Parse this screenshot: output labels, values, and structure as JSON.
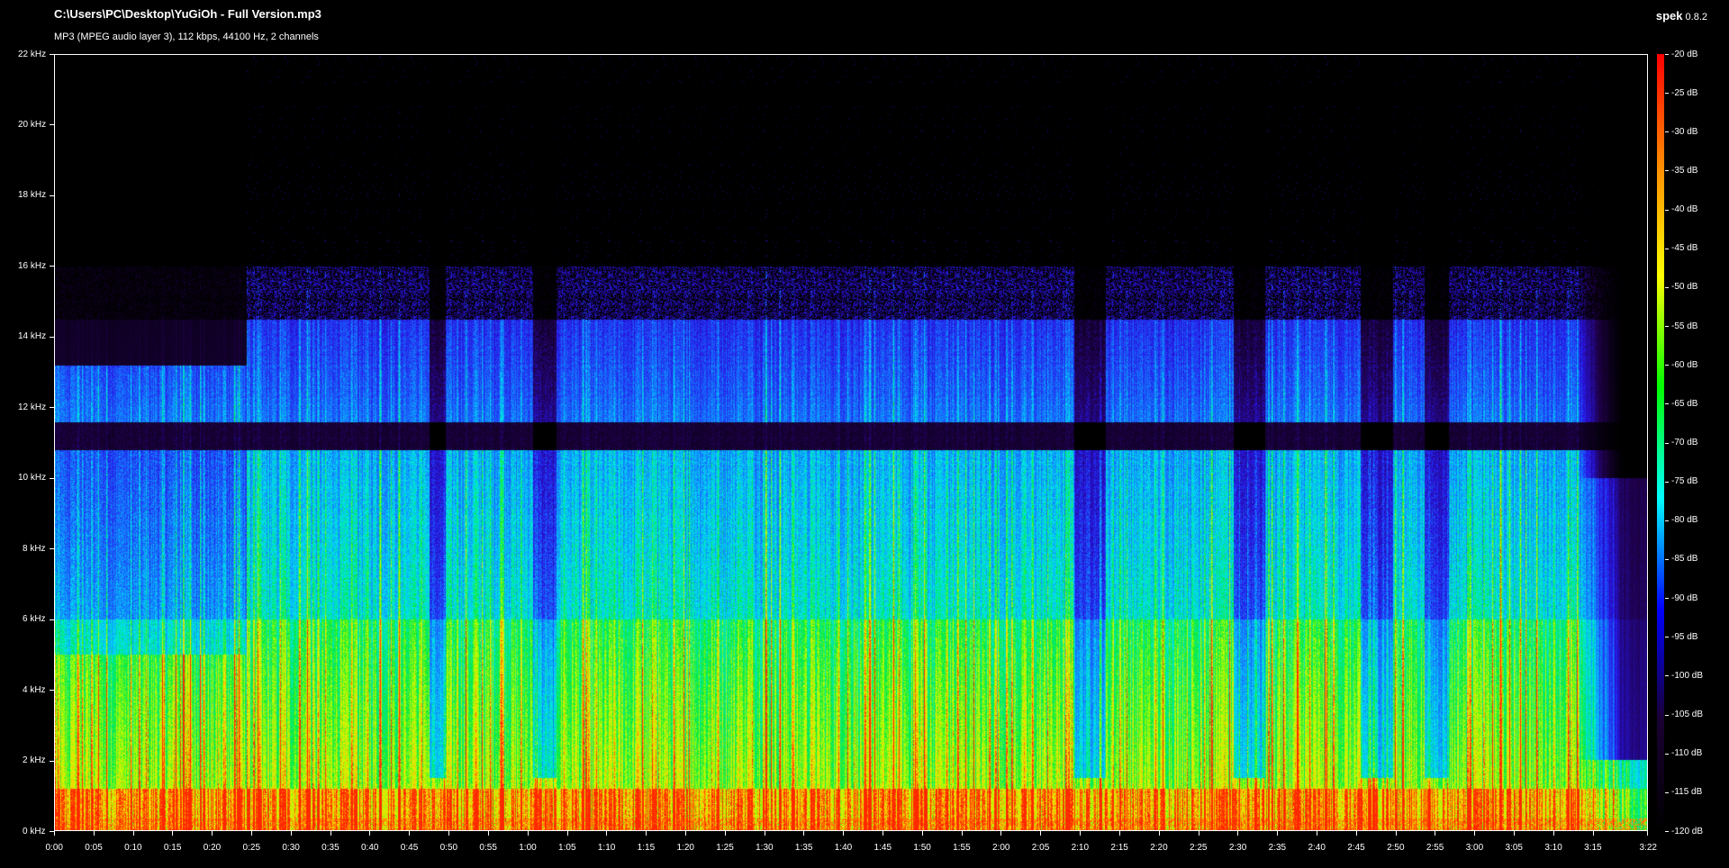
{
  "window": {
    "title": "C:\\Users\\PC\\Desktop\\YuGiOh - Full Version.mp3",
    "subtitle": "MP3 (MPEG audio layer 3), 112 kbps, 44100 Hz, 2 channels",
    "app_name": "spek",
    "app_version": "0.8.2"
  },
  "frequency_axis": {
    "labels": [
      "0 kHz",
      "2 kHz",
      "4 kHz",
      "6 kHz",
      "8 kHz",
      "10 kHz",
      "12 kHz",
      "14 kHz",
      "16 kHz",
      "18 kHz",
      "20 kHz",
      "22 kHz"
    ],
    "values_khz": [
      0,
      2,
      4,
      6,
      8,
      10,
      12,
      14,
      16,
      18,
      20,
      22
    ]
  },
  "time_axis": {
    "labels": [
      "0:00",
      "0:05",
      "0:10",
      "0:15",
      "0:20",
      "0:25",
      "0:30",
      "0:35",
      "0:40",
      "0:45",
      "0:50",
      "0:55",
      "1:00",
      "1:05",
      "1:10",
      "1:15",
      "1:20",
      "1:25",
      "1:30",
      "1:35",
      "1:40",
      "1:45",
      "1:50",
      "1:55",
      "2:00",
      "2:05",
      "2:10",
      "2:15",
      "2:20",
      "2:25",
      "2:30",
      "2:35",
      "2:40",
      "2:45",
      "2:50",
      "2:55",
      "3:00",
      "3:05",
      "3:10",
      "3:15",
      "3:22"
    ],
    "values_s": [
      0,
      5,
      10,
      15,
      20,
      25,
      30,
      35,
      40,
      45,
      50,
      55,
      60,
      65,
      70,
      75,
      80,
      85,
      90,
      95,
      100,
      105,
      110,
      115,
      120,
      125,
      130,
      135,
      140,
      145,
      150,
      155,
      160,
      165,
      170,
      175,
      180,
      185,
      190,
      195,
      202
    ],
    "duration_s": 202
  },
  "db_scale": {
    "labels": [
      "-20 dB",
      "-25 dB",
      "-30 dB",
      "-35 dB",
      "-40 dB",
      "-45 dB",
      "-50 dB",
      "-55 dB",
      "-60 dB",
      "-65 dB",
      "-70 dB",
      "-75 dB",
      "-80 dB",
      "-85 dB",
      "-90 dB",
      "-95 dB",
      "-100 dB",
      "-105 dB",
      "-110 dB",
      "-115 dB",
      "-120 dB"
    ],
    "values_db": [
      -20,
      -25,
      -30,
      -35,
      -40,
      -45,
      -50,
      -55,
      -60,
      -65,
      -70,
      -75,
      -80,
      -85,
      -90,
      -95,
      -100,
      -105,
      -110,
      -115,
      -120
    ],
    "colors": [
      "#ff0000",
      "#ff8c00",
      "#ffff00",
      "#00ff00",
      "#00ffff",
      "#0000ff",
      "#1a0033",
      "#000000"
    ]
  }
}
